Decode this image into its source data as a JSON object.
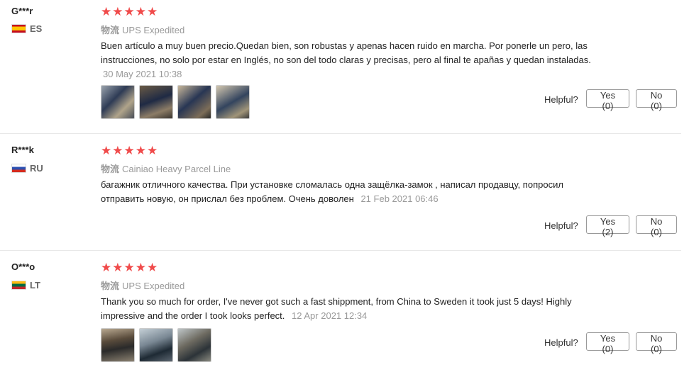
{
  "helpful_label": "Helpful?",
  "shipping_prefix": "物流",
  "reviews": [
    {
      "user": "G***r",
      "country": "ES",
      "stars": "★★★★★",
      "shipping": "UPS Expedited",
      "text": "Buen artículo a muy buen precio.Quedan bien, son robustas y apenas hacen ruido en marcha. Por ponerle un pero, las instrucciones, no solo por estar en Inglés, no son del todo claras y precisas, pero al final te apañas y quedan instaladas.",
      "date": "30 May 2021 10:38",
      "photo_count": 4,
      "yes": "Yes (0)",
      "no": "No (0)"
    },
    {
      "user": "R***k",
      "country": "RU",
      "stars": "★★★★★",
      "shipping": "Cainiao Heavy Parcel Line",
      "text": "багажник отличного качества. При установке сломалась одна защёлка-замок , написал продавцу, попросил отправить новую, он прислал без проблем. Очень доволен",
      "date": "21 Feb 2021 06:46",
      "photo_count": 0,
      "yes": "Yes (2)",
      "no": "No (0)"
    },
    {
      "user": "O***o",
      "country": "LT",
      "stars": "★★★★★",
      "shipping": "UPS Expedited",
      "text": "Thank you so much for order, I've never got such a fast shippment, from China to Sweden it took just 5 days! Highly impressive and the order I took looks perfect.",
      "date": "12 Apr 2021 12:34",
      "photo_count": 3,
      "yes": "Yes (0)",
      "no": "No (0)"
    }
  ]
}
